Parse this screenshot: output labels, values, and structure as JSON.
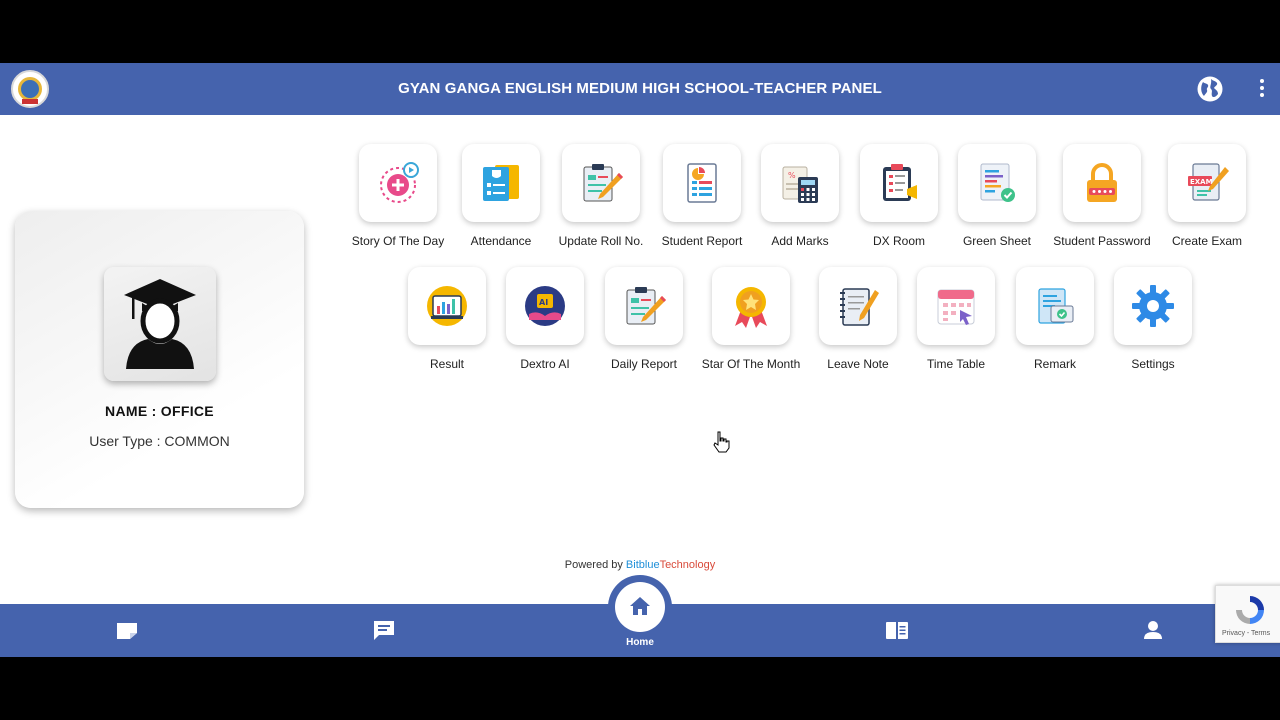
{
  "header": {
    "title": "GYAN GANGA ENGLISH MEDIUM HIGH SCHOOL-TEACHER PANEL",
    "logo_icon": "school-logo",
    "language_icon": "globe-icon",
    "menu_icon": "more-vertical-icon"
  },
  "profile": {
    "name": "NAME : OFFICE",
    "user_type": "User Type : COMMON"
  },
  "menu_row1": [
    {
      "label": "Story Of The Day",
      "icon": "story-icon"
    },
    {
      "label": "Attendance",
      "icon": "attendance-icon"
    },
    {
      "label": "Update Roll No.",
      "icon": "update-roll-icon"
    },
    {
      "label": "Student Report",
      "icon": "student-report-icon"
    },
    {
      "label": "Add Marks",
      "icon": "add-marks-icon"
    },
    {
      "label": "DX Room",
      "icon": "dx-room-icon"
    },
    {
      "label": "Green Sheet",
      "icon": "green-sheet-icon"
    },
    {
      "label": "Student Password",
      "icon": "student-password-icon"
    },
    {
      "label": "Create Exam",
      "icon": "create-exam-icon"
    }
  ],
  "menu_row2": [
    {
      "label": "Result",
      "icon": "result-icon"
    },
    {
      "label": "Dextro AI",
      "icon": "dextro-ai-icon"
    },
    {
      "label": "Daily Report",
      "icon": "daily-report-icon"
    },
    {
      "label": "Star Of The Month",
      "icon": "star-medal-icon"
    },
    {
      "label": "Leave Note",
      "icon": "leave-note-icon"
    },
    {
      "label": "Time Table",
      "icon": "time-table-icon"
    },
    {
      "label": "Remark",
      "icon": "remark-icon"
    },
    {
      "label": "Settings",
      "icon": "settings-gear-icon"
    }
  ],
  "exam_badge": "EXAM",
  "ai_badge": "AI",
  "footer": {
    "powered_prefix": "Powered by ",
    "brand_part1": "Bitblue",
    "brand_part2": "Technology"
  },
  "bottom_nav": {
    "home_label": "Home"
  },
  "recaptcha": {
    "text": "Privacy - Terms"
  },
  "colors": {
    "primary": "#4563ad",
    "brand_blue": "#1f8fd8",
    "brand_red": "#d94a3a"
  }
}
